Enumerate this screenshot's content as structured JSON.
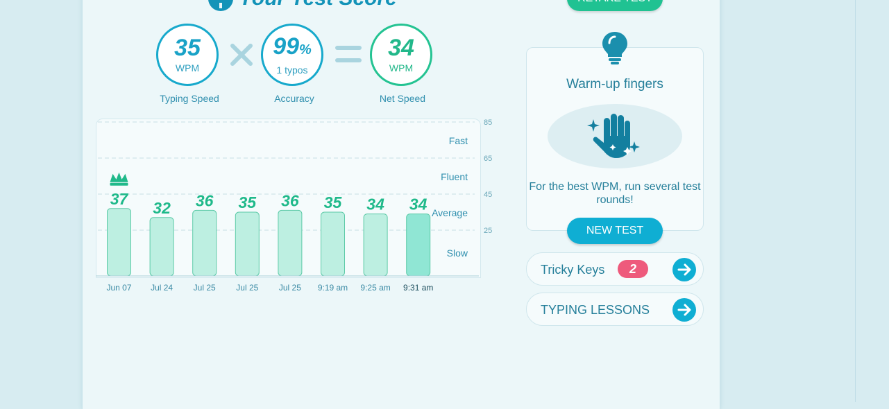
{
  "header": {
    "title": "Your Test Score",
    "retake_label": "RETAKE TEST"
  },
  "scores": {
    "speed": {
      "value": "35",
      "unit": "WPM",
      "caption": "Typing Speed"
    },
    "accuracy": {
      "value": "99",
      "percent": "%",
      "sub": "1 typos",
      "caption": "Accuracy"
    },
    "net": {
      "value": "34",
      "unit": "WPM",
      "caption": "Net Speed"
    }
  },
  "colors": {
    "teal": "#17a9cc",
    "green": "#24c392",
    "bar": "#bdefe1",
    "bar_last": "#90e6d4",
    "badge": "#ee5a7c"
  },
  "chart_data": {
    "type": "bar",
    "categories": [
      "Jun 07",
      "Jul 24",
      "Jul 25",
      "Jul 25",
      "Jul 25",
      "9:19 am",
      "9:25 am",
      "9:31 am"
    ],
    "values": [
      37,
      32,
      36,
      35,
      36,
      35,
      34,
      34
    ],
    "ylim": [
      0,
      85
    ],
    "yticks": [
      25,
      45,
      65,
      85
    ],
    "zones": [
      "Slow",
      "Average",
      "Fluent",
      "Fast"
    ],
    "best_index": 0,
    "current_index": 7,
    "grid": true
  },
  "tip": {
    "title": "Warm-up fingers",
    "text": "For the best WPM, run several test rounds!",
    "button": "NEW TEST"
  },
  "links": {
    "tricky_keys": {
      "label": "Tricky Keys",
      "count": "2"
    },
    "lessons": {
      "label": "TYPING LESSONS"
    }
  }
}
